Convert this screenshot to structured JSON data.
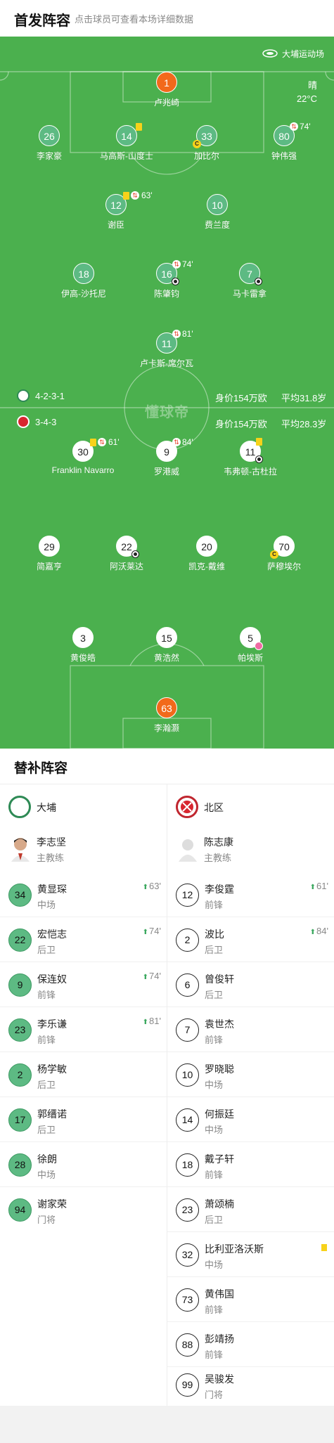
{
  "header": {
    "title": "首发阵容",
    "subtitle": "点击球员可查看本场详细数据"
  },
  "pitch": {
    "venue": "大埔运动场",
    "weather": {
      "condition": "晴",
      "temp": "22°C"
    },
    "watermark": "懂球帝",
    "home": {
      "formation": "4-2-3-1",
      "value": "身价154万欧",
      "age": "平均31.8岁",
      "color": "#5dba83"
    },
    "away": {
      "formation": "3-4-3",
      "value": "身价154万欧",
      "age": "平均28.3岁",
      "color": "#ffffff"
    }
  },
  "home_players": [
    {
      "num": "1",
      "name": "卢兆崎"
    },
    {
      "num": "26",
      "name": "李家豪"
    },
    {
      "num": "14",
      "name": "马高斯-山度士"
    },
    {
      "num": "33",
      "name": "加比尔"
    },
    {
      "num": "80",
      "name": "钟伟强",
      "sub": "74'"
    },
    {
      "num": "12",
      "name": "谢臣",
      "sub": "63'"
    },
    {
      "num": "10",
      "name": "费兰度"
    },
    {
      "num": "18",
      "name": "伊高-沙托尼"
    },
    {
      "num": "16",
      "name": "陈肇钧",
      "sub": "74'"
    },
    {
      "num": "7",
      "name": "马卡雷拿"
    },
    {
      "num": "11",
      "name": "卢卡斯-席尔瓦",
      "sub": "81'"
    }
  ],
  "away_players": [
    {
      "num": "30",
      "name": "Franklin Navarro",
      "sub": "61'"
    },
    {
      "num": "9",
      "name": "罗港威",
      "sub": "84'"
    },
    {
      "num": "11",
      "name": "韦弗顿-古杜拉"
    },
    {
      "num": "29",
      "name": "简嘉亨"
    },
    {
      "num": "22",
      "name": "阿沃莱达"
    },
    {
      "num": "20",
      "name": "凯克-戴维"
    },
    {
      "num": "70",
      "name": "萨穆埃尔"
    },
    {
      "num": "3",
      "name": "黄俊皓"
    },
    {
      "num": "15",
      "name": "黄浩然"
    },
    {
      "num": "5",
      "name": "帕埃斯"
    },
    {
      "num": "63",
      "name": "李瀚灏"
    }
  ],
  "subs": {
    "title": "替补阵容",
    "home": {
      "team": "大埔",
      "coach": {
        "name": "李志坚",
        "role": "主教练"
      },
      "players": [
        {
          "num": "34",
          "name": "黄显琛",
          "pos": "中场",
          "time": "63'"
        },
        {
          "num": "22",
          "name": "宏恺志",
          "pos": "后卫",
          "time": "74'"
        },
        {
          "num": "9",
          "name": "保连奴",
          "pos": "前锋",
          "time": "74'"
        },
        {
          "num": "23",
          "name": "李乐谦",
          "pos": "前锋",
          "time": "81'"
        },
        {
          "num": "2",
          "name": "杨学敏",
          "pos": "后卫"
        },
        {
          "num": "17",
          "name": "郭缙诺",
          "pos": "后卫"
        },
        {
          "num": "28",
          "name": "徐朗",
          "pos": "中场"
        },
        {
          "num": "94",
          "name": "谢家荣",
          "pos": "门将"
        }
      ]
    },
    "away": {
      "team": "北区",
      "coach": {
        "name": "陈志康",
        "role": "主教练"
      },
      "players": [
        {
          "num": "12",
          "name": "李俊霆",
          "pos": "前锋",
          "time": "61'"
        },
        {
          "num": "2",
          "name": "波比",
          "pos": "后卫",
          "time": "84'"
        },
        {
          "num": "6",
          "name": "曾俊轩",
          "pos": "后卫"
        },
        {
          "num": "7",
          "name": "袁世杰",
          "pos": "前锋"
        },
        {
          "num": "10",
          "name": "罗晓聪",
          "pos": "中场"
        },
        {
          "num": "14",
          "name": "何振廷",
          "pos": "中场"
        },
        {
          "num": "18",
          "name": "戴子轩",
          "pos": "前锋"
        },
        {
          "num": "23",
          "name": "萧颂楠",
          "pos": "后卫"
        },
        {
          "num": "32",
          "name": "比利亚洛沃斯",
          "pos": "中场",
          "card": "yellow"
        },
        {
          "num": "73",
          "name": "黄伟国",
          "pos": "前锋"
        },
        {
          "num": "88",
          "name": "彭靖扬",
          "pos": "前锋"
        },
        {
          "num": "99",
          "name": "吴骏发",
          "pos": "门将"
        }
      ]
    }
  }
}
